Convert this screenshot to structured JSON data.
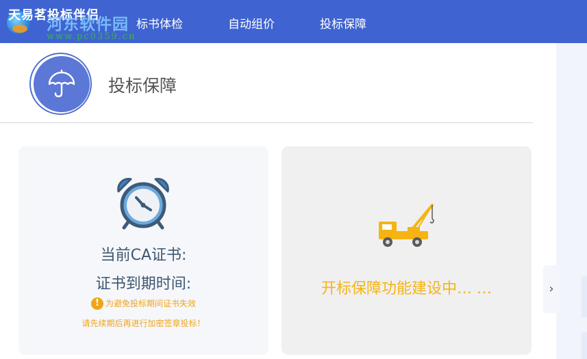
{
  "app": {
    "logo_text": "天易茗投标伴侣"
  },
  "watermark": {
    "site_name": "河东软件园",
    "url": "www.pc0359.cn"
  },
  "nav": {
    "items": [
      "标书体检",
      "自动组价",
      "投标保障"
    ]
  },
  "header": {
    "title": "投标保障",
    "icon": "umbrella-icon"
  },
  "cards": {
    "certificate": {
      "icon": "alarm-clock-icon",
      "ca_label": "当前CA证书:",
      "expiry_label": "证书到期时间:",
      "warning_icon": "exclamation-icon",
      "warning_line1": "为避免投标期间证书失效",
      "warning_line2": "请先续期后再进行加密签章投标！"
    },
    "bid_opening": {
      "icon": "crane-truck-icon",
      "status_text": "开标保障功能建设中… …"
    }
  },
  "sidebar": {
    "toggle_icon": "chevron-right-icon",
    "toggle_label": "›"
  },
  "colors": {
    "nav_bg": "#3f63d0",
    "accent_blue": "#5c78d6",
    "warning": "#f0a519",
    "building": "#f5b411"
  }
}
